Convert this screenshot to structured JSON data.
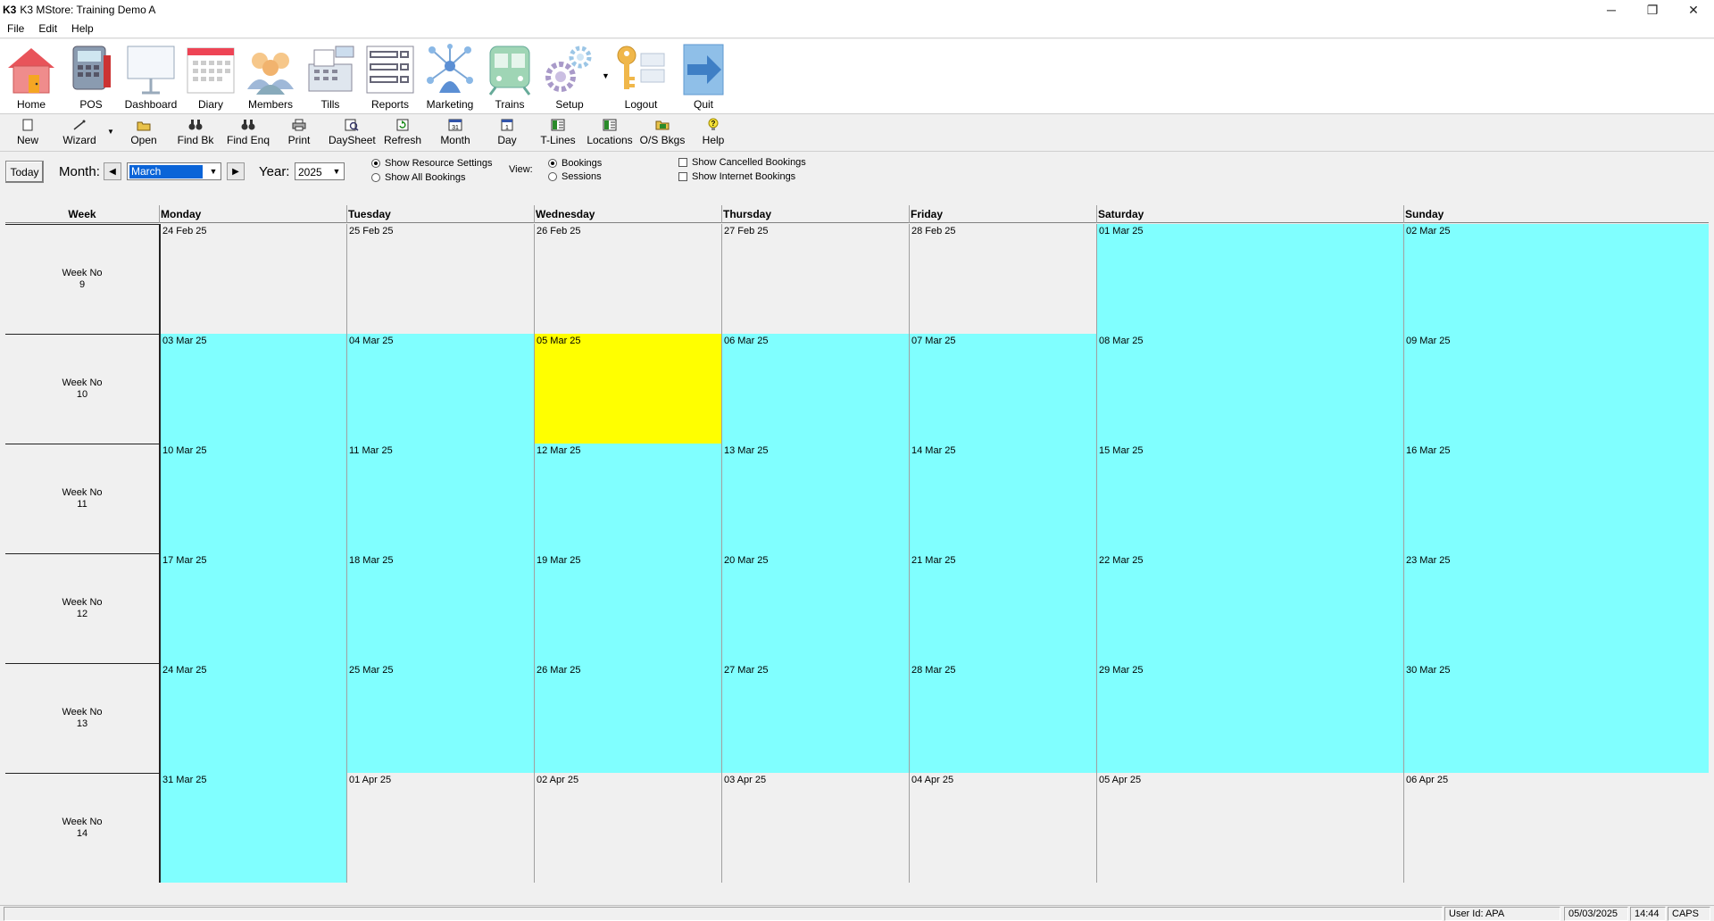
{
  "app": {
    "logo": "K3",
    "title": "K3 MStore: Training Demo A",
    "window_controls": {
      "minimize": "─",
      "restore": "❐",
      "close": "✕"
    }
  },
  "menu": [
    {
      "label": "File",
      "underline": "F"
    },
    {
      "label": "Edit",
      "underline": "E"
    },
    {
      "label": "Help",
      "underline": "H"
    }
  ],
  "big_toolbar": [
    {
      "label": "Home",
      "icon": "house-icon"
    },
    {
      "label": "POS",
      "icon": "pos-terminal-icon"
    },
    {
      "label": "Dashboard",
      "icon": "dashboard-board-icon"
    },
    {
      "label": "Diary",
      "icon": "calendar-icon"
    },
    {
      "label": "Members",
      "icon": "people-icon"
    },
    {
      "label": "Tills",
      "icon": "till-icon"
    },
    {
      "label": "Reports",
      "icon": "report-checklist-icon"
    },
    {
      "label": "Marketing",
      "icon": "network-icon"
    },
    {
      "label": "Trains",
      "icon": "train-icon"
    },
    {
      "label": "Setup",
      "icon": "gears-icon"
    },
    {
      "label": "Logout",
      "icon": "key-icon"
    },
    {
      "label": "Quit",
      "icon": "arrow-right-icon"
    }
  ],
  "small_toolbar": [
    {
      "label": "New",
      "icon": "new-doc-icon",
      "glyph": "🗋"
    },
    {
      "label": "Wizard",
      "icon": "wizard-wand-icon",
      "glyph": "⋰"
    },
    {
      "label": "Open",
      "icon": "folder-open-icon",
      "glyph": "📂"
    },
    {
      "label": "Find Bk",
      "icon": "binoculars-icon",
      "glyph": "⚲"
    },
    {
      "label": "Find Enq",
      "icon": "binoculars-icon",
      "glyph": "⚲"
    },
    {
      "label": "Print",
      "icon": "printer-icon",
      "glyph": "⎙"
    },
    {
      "label": "DaySheet",
      "icon": "daysheet-icon",
      "glyph": "🔍"
    },
    {
      "label": "Refresh",
      "icon": "refresh-icon",
      "glyph": "⟳"
    },
    {
      "label": "Month",
      "icon": "month-calendar-icon",
      "glyph": "31"
    },
    {
      "label": "Day",
      "icon": "day-calendar-icon",
      "glyph": "1"
    },
    {
      "label": "T-Lines",
      "icon": "t-lines-icon",
      "glyph": "▦"
    },
    {
      "label": "Locations",
      "icon": "locations-icon",
      "glyph": "▦"
    },
    {
      "label": "O/S Bkgs",
      "icon": "outstanding-bookings-icon",
      "glyph": "▤"
    },
    {
      "label": "Help",
      "icon": "help-bulb-icon",
      "glyph": "?"
    }
  ],
  "options": {
    "today_label": "Today",
    "month_label": "Month:",
    "month_value": "March",
    "year_label": "Year:",
    "year_value": "2025",
    "radio_show_resource": "Show Resource Settings",
    "radio_show_all": "Show All Bookings",
    "view_label": "View:",
    "radio_bookings": "Bookings",
    "radio_sessions": "Sessions",
    "chk_cancelled": "Show Cancelled Bookings",
    "chk_internet": "Show Internet Bookings"
  },
  "calendar": {
    "headers": [
      "Week",
      "Monday",
      "Tuesday",
      "Wednesday",
      "Thursday",
      "Friday",
      "Saturday",
      "Sunday"
    ],
    "week_label": "Week No",
    "weeks": [
      {
        "week_no": "9",
        "days": [
          {
            "date": "24 Feb 25",
            "state": "none"
          },
          {
            "date": "25 Feb 25",
            "state": "none"
          },
          {
            "date": "26 Feb 25",
            "state": "none"
          },
          {
            "date": "27 Feb 25",
            "state": "none"
          },
          {
            "date": "28 Feb 25",
            "state": "none"
          },
          {
            "date": "01 Mar 25",
            "state": "cyan"
          },
          {
            "date": "02 Mar 25",
            "state": "cyan"
          }
        ]
      },
      {
        "week_no": "10",
        "days": [
          {
            "date": "03 Mar 25",
            "state": "cyan"
          },
          {
            "date": "04 Mar 25",
            "state": "cyan"
          },
          {
            "date": "05 Mar 25",
            "state": "yellow"
          },
          {
            "date": "06 Mar 25",
            "state": "cyan"
          },
          {
            "date": "07 Mar 25",
            "state": "cyan"
          },
          {
            "date": "08 Mar 25",
            "state": "cyan"
          },
          {
            "date": "09 Mar 25",
            "state": "cyan"
          }
        ]
      },
      {
        "week_no": "11",
        "days": [
          {
            "date": "10 Mar 25",
            "state": "cyan"
          },
          {
            "date": "11 Mar 25",
            "state": "cyan"
          },
          {
            "date": "12 Mar 25",
            "state": "cyan"
          },
          {
            "date": "13 Mar 25",
            "state": "cyan"
          },
          {
            "date": "14 Mar 25",
            "state": "cyan"
          },
          {
            "date": "15 Mar 25",
            "state": "cyan"
          },
          {
            "date": "16 Mar 25",
            "state": "cyan"
          }
        ]
      },
      {
        "week_no": "12",
        "days": [
          {
            "date": "17 Mar 25",
            "state": "cyan"
          },
          {
            "date": "18 Mar 25",
            "state": "cyan"
          },
          {
            "date": "19 Mar 25",
            "state": "cyan"
          },
          {
            "date": "20 Mar 25",
            "state": "cyan"
          },
          {
            "date": "21 Mar 25",
            "state": "cyan"
          },
          {
            "date": "22 Mar 25",
            "state": "cyan"
          },
          {
            "date": "23 Mar 25",
            "state": "cyan"
          }
        ]
      },
      {
        "week_no": "13",
        "days": [
          {
            "date": "24 Mar 25",
            "state": "cyan"
          },
          {
            "date": "25 Mar 25",
            "state": "cyan"
          },
          {
            "date": "26 Mar 25",
            "state": "cyan"
          },
          {
            "date": "27 Mar 25",
            "state": "cyan"
          },
          {
            "date": "28 Mar 25",
            "state": "cyan"
          },
          {
            "date": "29 Mar 25",
            "state": "cyan"
          },
          {
            "date": "30 Mar 25",
            "state": "cyan"
          }
        ]
      },
      {
        "week_no": "14",
        "days": [
          {
            "date": "31 Mar 25",
            "state": "cyan"
          },
          {
            "date": "01 Apr 25",
            "state": "none"
          },
          {
            "date": "02 Apr 25",
            "state": "none"
          },
          {
            "date": "03 Apr 25",
            "state": "none"
          },
          {
            "date": "04 Apr 25",
            "state": "none"
          },
          {
            "date": "05 Apr 25",
            "state": "none"
          },
          {
            "date": "06 Apr 25",
            "state": "none"
          }
        ]
      }
    ]
  },
  "colors": {
    "in_month": "#80ffff",
    "today": "#ffff00",
    "out_of_month": "#f0f0f0"
  },
  "status": {
    "user": "User Id: APA",
    "date": "05/03/2025",
    "time": "14:44",
    "caps": "CAPS"
  }
}
